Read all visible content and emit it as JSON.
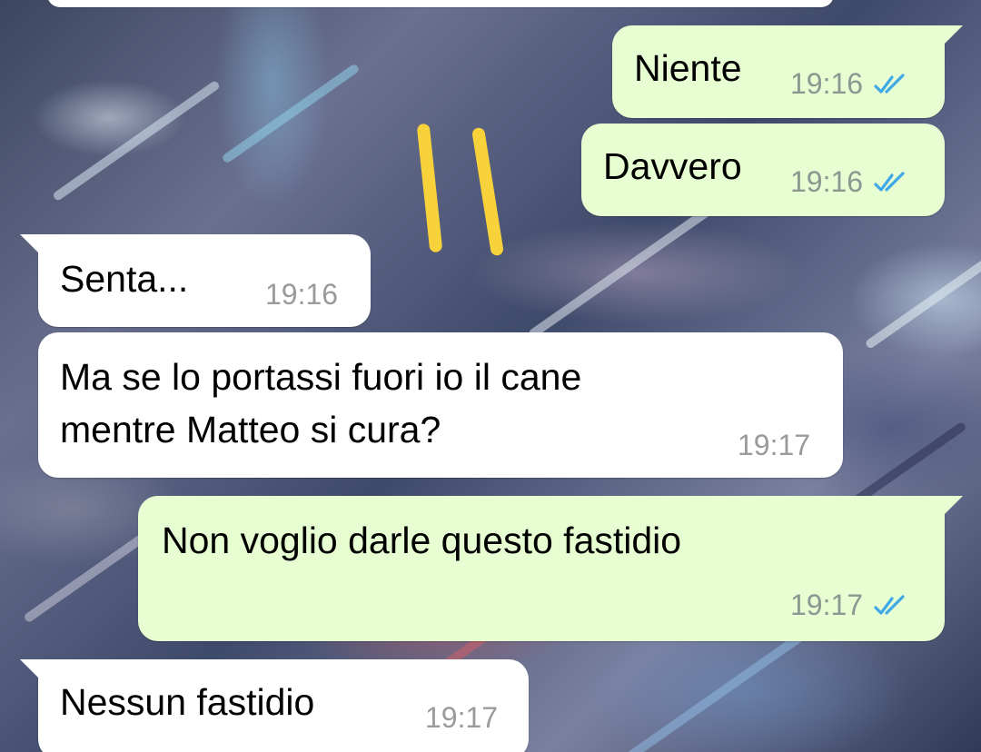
{
  "messages": [
    {
      "id": "m1",
      "direction": "outgoing",
      "text": "Niente",
      "time": "19:16",
      "status_icon": "double-check-read"
    },
    {
      "id": "m2",
      "direction": "outgoing",
      "text": "Davvero",
      "time": "19:16",
      "status_icon": "double-check-read"
    },
    {
      "id": "m3",
      "direction": "incoming",
      "text": "Senta...",
      "time": "19:16"
    },
    {
      "id": "m4",
      "direction": "incoming",
      "text": "Ma se lo portassi fuori io il cane\nmentre Matteo si cura?",
      "time": "19:17"
    },
    {
      "id": "m5",
      "direction": "outgoing",
      "text": "Non voglio darle questo fastidio",
      "time": "19:17",
      "status_icon": "double-check-read"
    },
    {
      "id": "m6",
      "direction": "incoming",
      "text": "Nessun fastidio",
      "time": "19:17"
    }
  ],
  "colors": {
    "outgoing_bubble": "#e7fed2",
    "incoming_bubble": "#ffffff",
    "read_ticks": "#3fa9e8",
    "timestamp": "#8b9790",
    "marker": "#f7d23a"
  }
}
